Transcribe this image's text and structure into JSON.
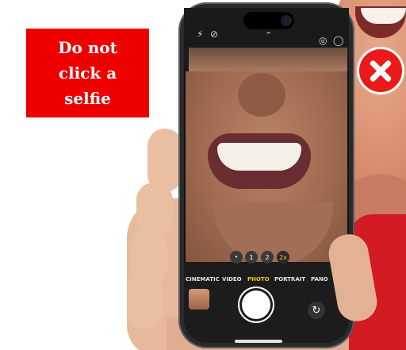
{
  "sign": {
    "text": "Do not click a selfie"
  },
  "camera": {
    "top_icons": {
      "flash": "⚡",
      "live_off": "⊘",
      "chevron": "⌃",
      "live": "◎",
      "circle": "◯"
    },
    "zoom": {
      "dot": "•",
      "z1": "1",
      "z2": "2",
      "z3": "2x"
    },
    "modes": {
      "cinematic": "CINEMATIC",
      "video": "VIDEO",
      "photo": "PHOTO",
      "portrait": "PORTRAIT",
      "pano": "PANO"
    },
    "flip_icon": "↻"
  },
  "colors": {
    "sign_bg": "#ee0000",
    "x_badge": "#ea1a1a",
    "active_mode": "#f5c400"
  }
}
